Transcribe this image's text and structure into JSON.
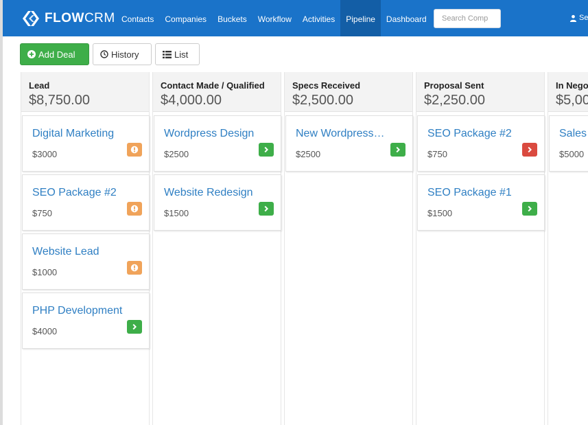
{
  "navbar": {
    "brand": {
      "prefix": "FLOW",
      "suffix": "CRM"
    },
    "items": [
      {
        "label": "Contacts"
      },
      {
        "label": "Companies"
      },
      {
        "label": "Buckets"
      },
      {
        "label": "Workflow"
      },
      {
        "label": "Activities"
      },
      {
        "label": "Pipeline",
        "active": true
      },
      {
        "label": "Dashboard"
      }
    ],
    "search": {
      "placeholder": "Search Comp"
    },
    "user": {
      "label": "Se",
      "icon": "user-icon"
    }
  },
  "toolbar": {
    "add_deal": {
      "label": "Add Deal",
      "icon": "plus-circle-icon"
    },
    "history": {
      "label": "History",
      "icon": "clock-icon"
    },
    "list": {
      "label": "List",
      "icon": "list-icon"
    }
  },
  "colors": {
    "accent": "#1a73c9",
    "success": "#3eae49",
    "warning": "#f0a35a",
    "danger": "#da4a3f",
    "link": "#2f7fc3"
  },
  "pipeline": {
    "columns": [
      {
        "name": "Lead",
        "total": "$8,750.00",
        "cards": [
          {
            "title": "Digital Marketing",
            "amount": "$3000",
            "status": "warning",
            "icon": "info-icon"
          },
          {
            "title": "SEO Package #2",
            "amount": "$750",
            "status": "warning",
            "icon": "info-icon"
          },
          {
            "title": "Website Lead",
            "amount": "$1000",
            "status": "warning",
            "icon": "info-icon"
          },
          {
            "title": "PHP Development",
            "amount": "$4000",
            "status": "success",
            "icon": "chevron-right-icon"
          }
        ]
      },
      {
        "name": "Contact Made / Qualified",
        "total": "$4,000.00",
        "cards": [
          {
            "title": "Wordpress Design",
            "amount": "$2500",
            "status": "success",
            "icon": "chevron-right-icon"
          },
          {
            "title": "Website Redesign",
            "amount": "$1500",
            "status": "success",
            "icon": "chevron-right-icon"
          }
        ]
      },
      {
        "name": "Specs Received",
        "total": "$2,500.00",
        "cards": [
          {
            "title": "New Wordpress…",
            "amount": "$2500",
            "status": "success",
            "icon": "chevron-right-icon"
          }
        ]
      },
      {
        "name": "Proposal Sent",
        "total": "$2,250.00",
        "cards": [
          {
            "title": "SEO Package #2",
            "amount": "$750",
            "status": "danger",
            "icon": "chevron-right-icon"
          },
          {
            "title": "SEO Package #1",
            "amount": "$1500",
            "status": "success",
            "icon": "chevron-right-icon"
          }
        ]
      },
      {
        "name": "In Nego",
        "total": "$5,00",
        "cards": [
          {
            "title": "Sales I",
            "amount": "$5000",
            "status": "success",
            "icon": "chevron-right-icon"
          }
        ]
      }
    ]
  }
}
